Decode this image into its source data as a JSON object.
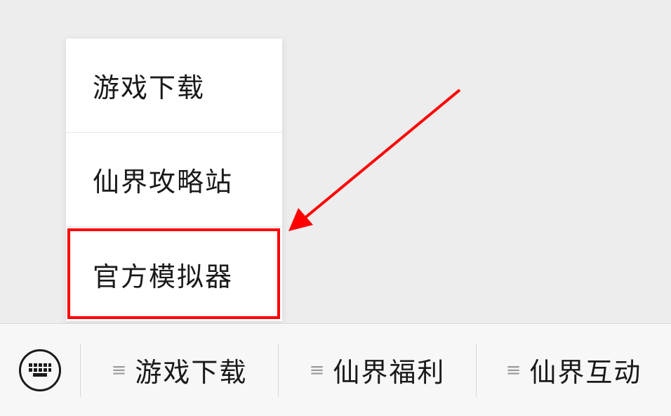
{
  "popup_menu": {
    "items": [
      {
        "label": "游戏下载"
      },
      {
        "label": "仙界攻略站"
      },
      {
        "label": "官方模拟器"
      }
    ]
  },
  "bottom_bar": {
    "keyboard_icon": "keyboard-icon",
    "tabs": [
      {
        "label": "游戏下载",
        "icon": "menu-icon"
      },
      {
        "label": "仙界福利",
        "icon": "menu-icon"
      },
      {
        "label": "仙界互动",
        "icon": "menu-icon"
      }
    ]
  },
  "colors": {
    "annotation": "#ff0000",
    "background": "#ededed",
    "bar": "#f7f7f7"
  }
}
